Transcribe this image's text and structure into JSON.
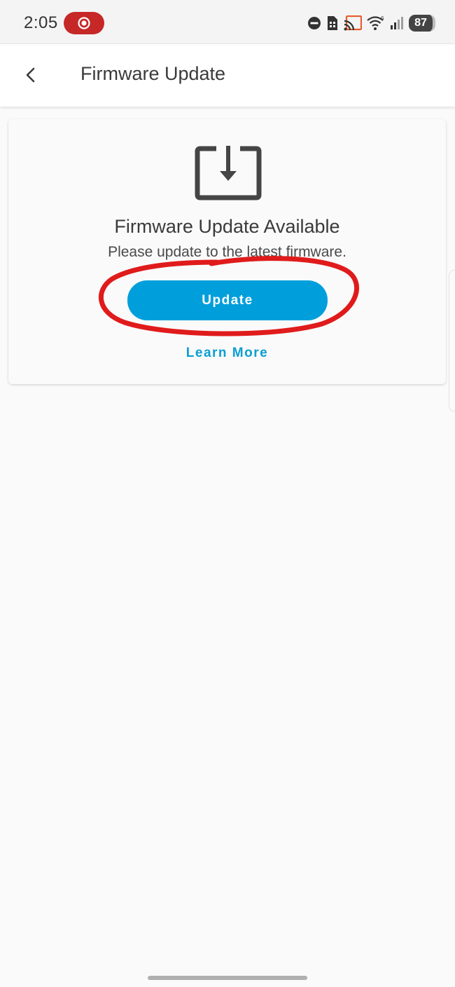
{
  "status_bar": {
    "time": "2:05",
    "battery": "87",
    "icons": [
      "record-icon",
      "do-not-disturb-icon",
      "sim-icon",
      "cast-icon",
      "wifi-icon",
      "signal-icon"
    ]
  },
  "header": {
    "title": "Firmware Update",
    "back_icon": "chevron-left-icon"
  },
  "card": {
    "icon": "download-icon",
    "heading": "Firmware Update Available",
    "subtext": "Please update to the latest firmware.",
    "update_button": "Update",
    "learn_more": "Learn More"
  },
  "colors": {
    "accent": "#009fdb",
    "link": "#0a9fd2",
    "annotation": "#e01b1b",
    "record_pill": "#c62828"
  }
}
